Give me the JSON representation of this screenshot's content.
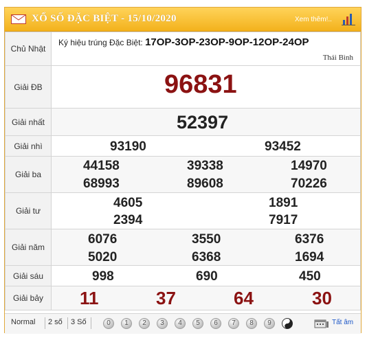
{
  "header": {
    "title": "XỔ SỐ ĐẶC BIỆT -  15/10/2020",
    "more_link": "Xem thêm!.."
  },
  "info": {
    "day_label": "Chủ Nhật",
    "ky_hieu_label": "Ký hiệu trúng Đặc Biệt: ",
    "ky_hieu_value": "17OP-3OP-23OP-9OP-12OP-24OP",
    "province": "Thái Bình"
  },
  "prizes": {
    "db": {
      "label": "Giải ĐB",
      "numbers": [
        "96831"
      ]
    },
    "nhat": {
      "label": "Giải nhất",
      "numbers": [
        "52397"
      ]
    },
    "nhi": {
      "label": "Giải nhì",
      "numbers": [
        "93190",
        "93452"
      ]
    },
    "ba": {
      "label": "Giải ba",
      "numbers": [
        "44158",
        "39338",
        "14970",
        "68993",
        "89608",
        "70226"
      ]
    },
    "tu": {
      "label": "Giải tư",
      "numbers": [
        "4605",
        "1891",
        "2394",
        "7917"
      ]
    },
    "nam": {
      "label": "Giải năm",
      "numbers": [
        "6076",
        "3550",
        "6376",
        "5020",
        "6368",
        "1694"
      ]
    },
    "sau": {
      "label": "Giải sáu",
      "numbers": [
        "998",
        "690",
        "450"
      ]
    },
    "bay": {
      "label": "Giải bảy",
      "numbers": [
        "11",
        "37",
        "64",
        "30"
      ]
    }
  },
  "footer": {
    "tabs": [
      "Normal",
      "2 số",
      "3 Số"
    ],
    "digits": [
      "0",
      "1",
      "2",
      "3",
      "4",
      "5",
      "6",
      "7",
      "8",
      "9"
    ],
    "all_label": "Tất âm"
  },
  "colors": {
    "header_gradient_top": "#ffd35a",
    "header_gradient_bottom": "#f3b21c",
    "border": "#e0a83a",
    "special_prize": "#8b1212",
    "link": "#1d57c7"
  }
}
